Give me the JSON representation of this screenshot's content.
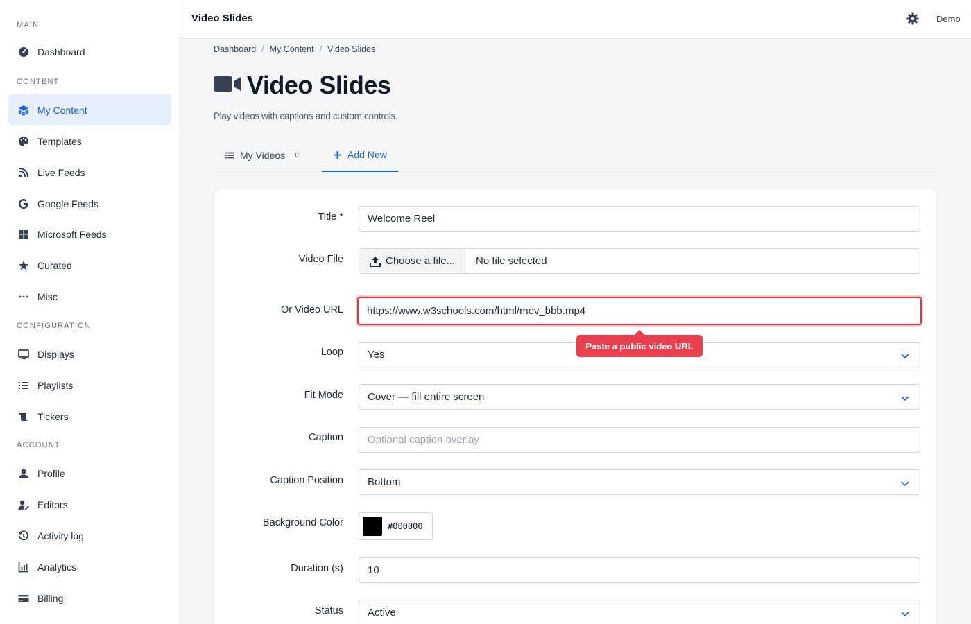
{
  "sidebar": {
    "sections": {
      "main": "MAIN",
      "content": "CONTENT",
      "configuration": "CONFIGURATION",
      "account": "ACCOUNT"
    },
    "items": {
      "dashboard": "Dashboard",
      "my_content": "My Content",
      "templates": "Templates",
      "live_feeds": "Live Feeds",
      "google_feeds": "Google Feeds",
      "microsoft_feeds": "Microsoft Feeds",
      "curated": "Curated",
      "misc": "Misc",
      "displays": "Displays",
      "playlists": "Playlists",
      "tickers": "Tickers",
      "profile": "Profile",
      "editors": "Editors",
      "activity_log": "Activity log",
      "analytics": "Analytics",
      "billing": "Billing"
    },
    "active_item": "My Content",
    "accent": "#1d5fd6"
  },
  "topbar": {
    "title": "Video Slides",
    "user": "Demo"
  },
  "breadcrumb": [
    "Dashboard",
    "My Content",
    "Video Slides"
  ],
  "page": {
    "title": "Video Slides",
    "subtitle": "Play videos with captions and custom controls."
  },
  "tabs": {
    "my_videos": {
      "label": "My Videos",
      "count": "0"
    },
    "add_new": {
      "label": "Add New"
    }
  },
  "form": {
    "title": {
      "label": "Title *",
      "value": "Welcome Reel"
    },
    "video_file": {
      "label": "Video File",
      "button": "Choose a file...",
      "status": "No file selected"
    },
    "video_url": {
      "label": "Or Video URL",
      "value": "https://www.w3schools.com/html/mov_bbb.mp4",
      "tooltip": "Paste a public video URL"
    },
    "loop": {
      "label": "Loop",
      "value": "Yes"
    },
    "fit_mode": {
      "label": "Fit Mode",
      "value": "Cover — fill entire screen"
    },
    "caption": {
      "label": "Caption",
      "placeholder": "Optional caption overlay"
    },
    "caption_position": {
      "label": "Caption Position",
      "value": "Bottom"
    },
    "background_color": {
      "label": "Background Color",
      "value": "#000000"
    },
    "duration": {
      "label": "Duration (s)",
      "value": "10"
    },
    "status": {
      "label": "Status",
      "value": "Active"
    }
  },
  "colors": {
    "error": "#dc3545",
    "tooltip": "#e9404f"
  }
}
